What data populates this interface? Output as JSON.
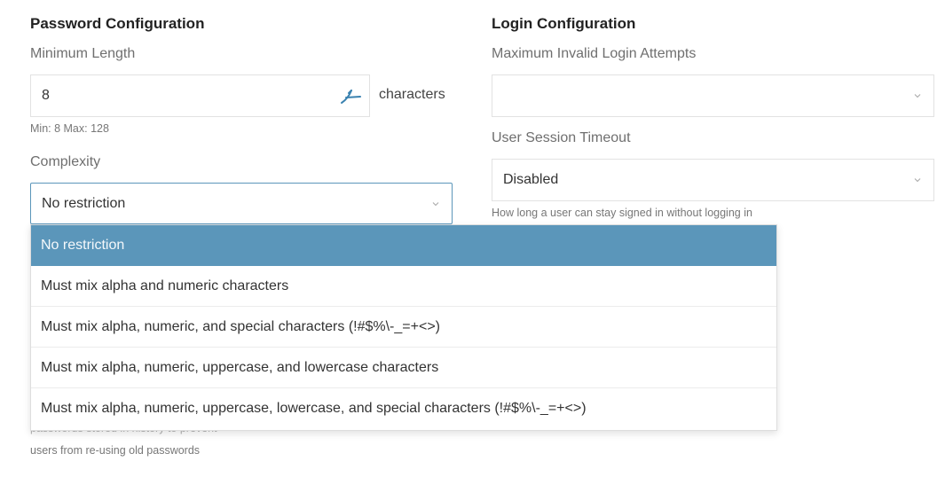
{
  "password_config": {
    "title": "Password Configuration",
    "min_length": {
      "label": "Minimum Length",
      "value": "8",
      "unit": "characters",
      "help": "Min: 8 Max: 128"
    },
    "complexity": {
      "label": "Complexity",
      "selected": "No restriction",
      "options": [
        "No restriction",
        "Must mix alpha and numeric characters",
        "Must mix alpha, numeric, and special characters (!#$%\\-_=+<>)",
        "Must mix alpha, numeric, uppercase, and lowercase characters",
        "Must mix alpha, numeric, uppercase, lowercase, and special characters (!#$%\\-_=+<>)"
      ]
    },
    "history_help_partial": "passwords stored in history to prevent",
    "history_help": "users from re-using old passwords"
  },
  "login_config": {
    "title": "Login Configuration",
    "max_attempts": {
      "label": "Maximum Invalid Login Attempts",
      "value": ""
    },
    "session_timeout": {
      "label": "User Session Timeout",
      "value": "Disabled",
      "help": "How long a user can stay signed in without logging in"
    }
  },
  "colors": {
    "accent": "#5b96ba",
    "stepper_icon": "#3a82b0"
  },
  "icons": {
    "stepper": "spinner-arrows-icon",
    "dropdown": "chevron-down-icon"
  }
}
